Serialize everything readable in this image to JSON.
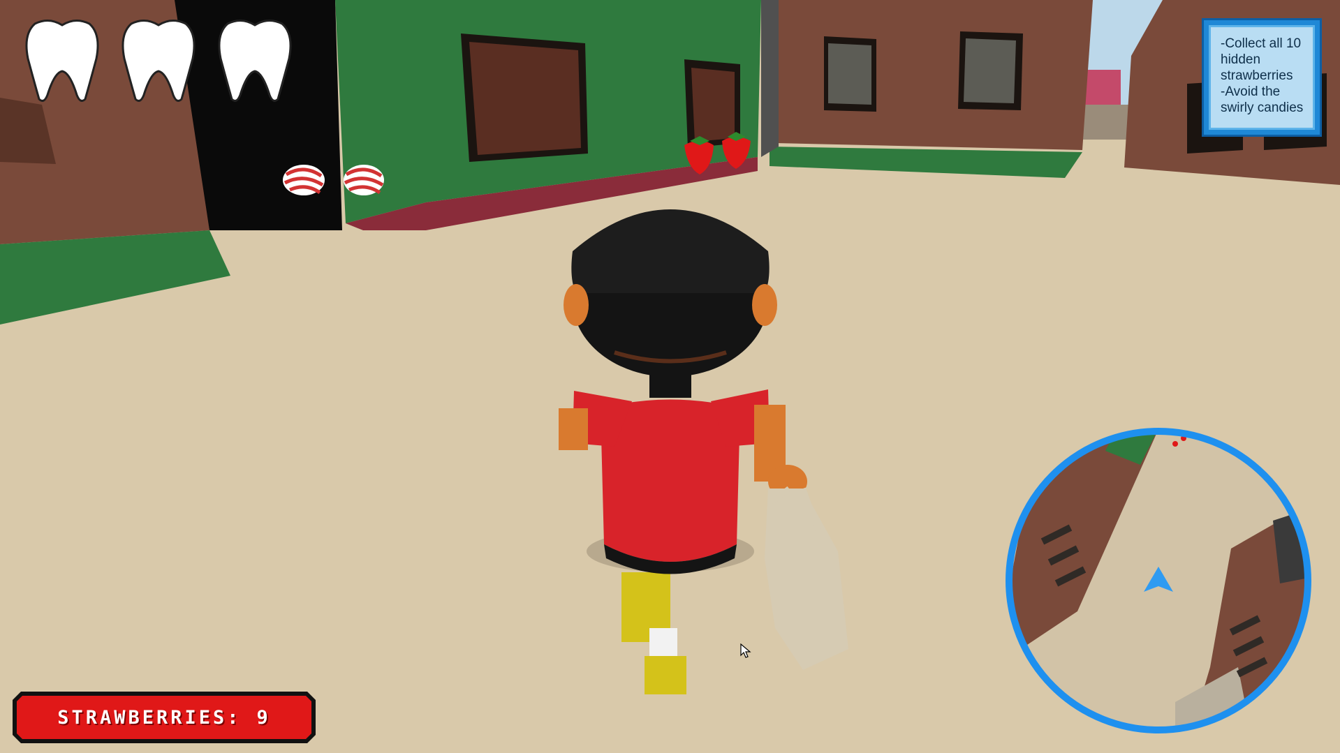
{
  "hud": {
    "lives": {
      "count": 3,
      "icon": "tooth-icon",
      "color": "#ffffff"
    },
    "objectives": {
      "lines": [
        "-Collect all 10",
        "hidden",
        "strawberries",
        "-Avoid the",
        "swirly candies"
      ]
    },
    "counter": {
      "label": "STRAWBERRIES:",
      "value": "9"
    },
    "minimap": {
      "player_marker": "arrow-up-icon",
      "ring_color": "#1e90ef"
    }
  },
  "colors": {
    "ground": "#d9c9aa",
    "building_green": "#2f7a3e",
    "building_brown": "#7a4a3a",
    "shirt": "#d8232a",
    "shorts": "#d4c21a",
    "hair": "#141414"
  }
}
